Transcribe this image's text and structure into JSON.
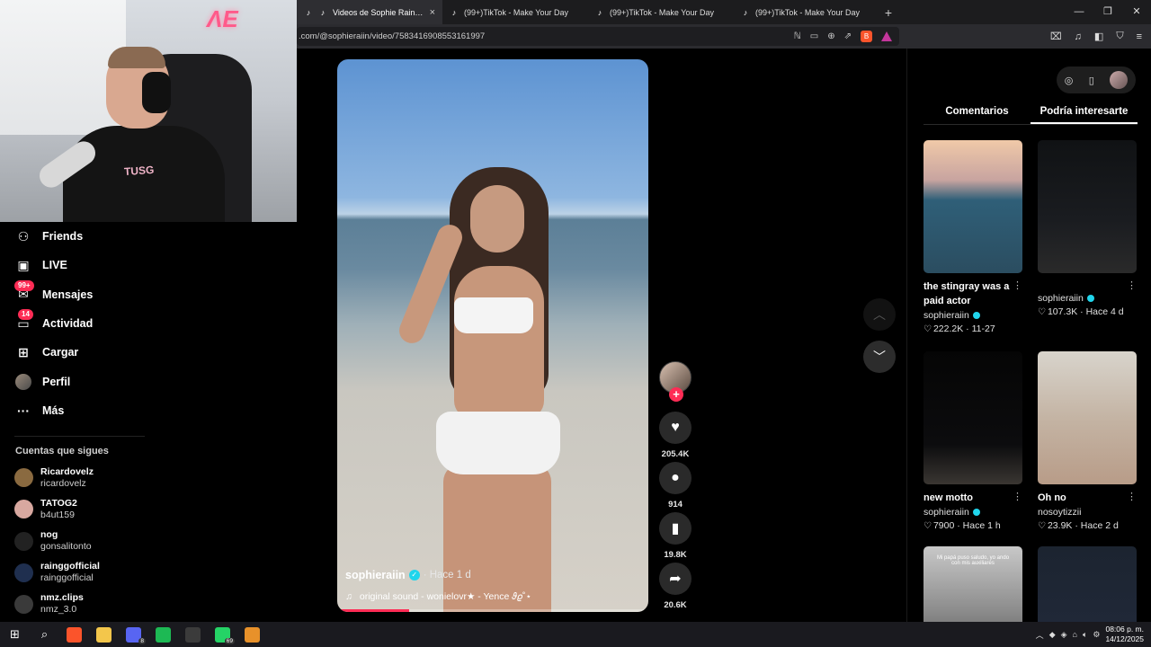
{
  "browser": {
    "tabs": [
      {
        "title": "Videos de Sophie Rain (@sop",
        "active": true,
        "close": "×"
      },
      {
        "title": "(99+)TikTok - Make Your Day",
        "active": false
      },
      {
        "title": "(99+)TikTok - Make Your Day",
        "active": false
      },
      {
        "title": "(99+)TikTok - Make Your Day",
        "active": false
      }
    ],
    "new_tab": "+",
    "url": ".com/@sophieraiin/video/7583416908553161997",
    "window_controls": [
      "—",
      "❐",
      "✕"
    ]
  },
  "webcam": {
    "neon_text": "ΛE",
    "shirt_text": "TUSG"
  },
  "sidebar": {
    "items": [
      {
        "label": "Friends",
        "icon": "friends-icon",
        "glyph": "⚇"
      },
      {
        "label": "LIVE",
        "icon": "live-icon",
        "glyph": "▣"
      },
      {
        "label": "Mensajes",
        "icon": "messages-icon",
        "glyph": "✉",
        "badge": "99+"
      },
      {
        "label": "Actividad",
        "icon": "activity-icon",
        "glyph": "▭",
        "badge": "14"
      },
      {
        "label": "Cargar",
        "icon": "upload-icon",
        "glyph": "⊞"
      },
      {
        "label": "Perfil",
        "icon": "profile-icon",
        "glyph": ""
      },
      {
        "label": "Más",
        "icon": "more-icon",
        "glyph": "···"
      }
    ],
    "following_title": "Cuentas que sigues",
    "following": [
      {
        "name": "Ricardovelz",
        "handle": "ricardovelz",
        "color": "#8a6a40"
      },
      {
        "name": "TATOG2",
        "handle": "b4ut159",
        "color": "#d8a8a0"
      },
      {
        "name": "nog",
        "handle": "gonsalitonto",
        "color": "#222222"
      },
      {
        "name": "rainggofficial",
        "handle": "rainggofficial",
        "color": "#1f2f4f"
      },
      {
        "name": "nmz.clips",
        "handle": "nmz_3.0",
        "color": "#3a3a3a"
      }
    ]
  },
  "video": {
    "author": "sophieraiin",
    "age": "· Hace 1 d",
    "sound": "original sound - wonielovr★ - Yence 𝜗𝜚˚⋆",
    "progress": 0.23
  },
  "actions": {
    "likes": "205.4K",
    "comments": "914",
    "saves": "19.8K",
    "shares": "20.6K"
  },
  "right_panel": {
    "tabs": [
      "Comentarios",
      "Podría interesarte"
    ],
    "active_tab": 1,
    "cards": [
      {
        "title": "the stingray was a paid actor",
        "author": "sophieraiin",
        "verified": true,
        "likes": "222.2K",
        "date": "11-27",
        "bg": "linear-gradient(180deg,#f0c9a8 0%,#c8a4a0 30%,#2f5f78 45%,#2b4d60 100%)"
      },
      {
        "title": "",
        "author": "sophieraiin",
        "verified": true,
        "likes": "107.3K",
        "date": "Hace 4 d",
        "bg": "linear-gradient(180deg,#101214 0%,#1a1c20 60%,#2a2a2a 100%)"
      },
      {
        "title": "new motto",
        "author": "sophieraiin",
        "verified": true,
        "likes": "7900",
        "date": "Hace 1 h",
        "bg": "linear-gradient(180deg,#050505 0%,#0c0c0e 70%,#3a3632 100%)"
      },
      {
        "title": "Oh no",
        "author": "nosoytizzii",
        "verified": false,
        "likes": "23.9K",
        "date": "Hace 2 d",
        "bg": "linear-gradient(180deg,#d8d4cc 0%,#c4b4a4 50%,#b89c88 100%)"
      },
      {
        "title": "",
        "author": "",
        "verified": false,
        "likes": "",
        "date": "",
        "bg": "linear-gradient(180deg,#c8c8c8 0%,#8a8a8a 50%,#3a3a3a 100%)",
        "overlay": "Mi papá puso saludo, yo ando con mis auxiliares"
      },
      {
        "title": "",
        "author": "",
        "verified": false,
        "likes": "",
        "date": "",
        "bg": "linear-gradient(180deg,#1c2430 0%,#202838 60%,#0a0c10 100%)"
      }
    ]
  },
  "taskbar": {
    "apps": [
      {
        "name": "windows-start-icon",
        "glyph": "⊞",
        "color": "#ffffff"
      },
      {
        "name": "search-icon",
        "glyph": "⌕",
        "color": "#ffffff"
      },
      {
        "name": "brave-icon",
        "glyph": "",
        "color": "#fb542b"
      },
      {
        "name": "file-explorer-icon",
        "glyph": "",
        "color": "#f3c64b"
      },
      {
        "name": "discord-icon",
        "glyph": "",
        "color": "#5865f2",
        "badge": "8"
      },
      {
        "name": "spotify-icon",
        "glyph": "",
        "color": "#1db954"
      },
      {
        "name": "obs-icon",
        "glyph": "",
        "color": "#3b3b3b"
      },
      {
        "name": "whatsapp-icon",
        "glyph": "",
        "color": "#25d366",
        "badge": "69"
      },
      {
        "name": "app-icon",
        "glyph": "",
        "color": "#e8912a"
      }
    ],
    "time": "08:06 p. m.",
    "date": "14/12/2025"
  }
}
